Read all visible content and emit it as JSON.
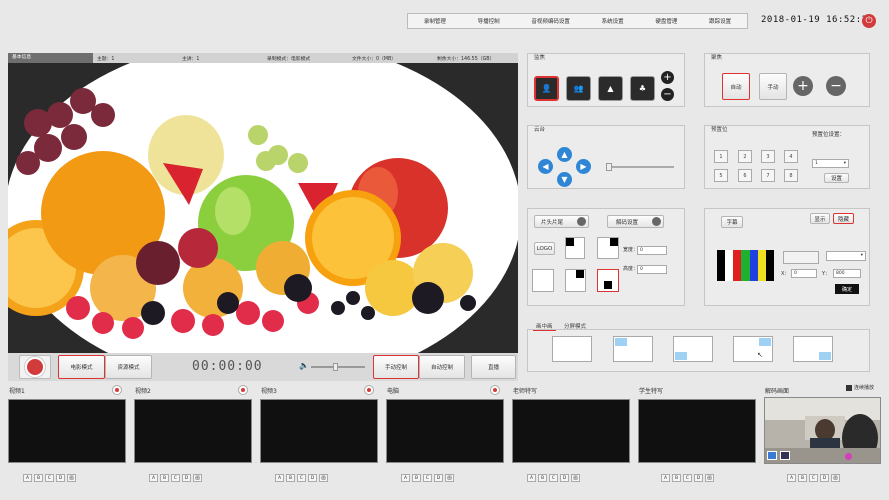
{
  "topnav": [
    "录制管理",
    "导播控制",
    "音视频编码设置",
    "系统设置",
    "硬盘管理",
    "跟踪设置"
  ],
  "clock": "2018-01-19 16:52:21",
  "power_icon": "power-icon",
  "infobar": [
    "基本信息",
    "主题：1",
    "主讲：1",
    "录制模式：电影模式",
    "文件大小：0（MB）",
    "剩余大小：146.55（GB）"
  ],
  "controls": {
    "movie_mode": "电影模式",
    "resource_mode": "资源模式",
    "timecode": "00:00:00",
    "manual_control": "手动控制",
    "auto_control": "自动控制",
    "live": "直播"
  },
  "sources": [
    {
      "label": "视频1"
    },
    {
      "label": "视频2"
    },
    {
      "label": "视频3"
    },
    {
      "label": "电脑"
    },
    {
      "label": "老师特写"
    },
    {
      "label": "学生特写"
    },
    {
      "label": "解码画面"
    }
  ],
  "continuous_play": "连续播放",
  "mini_buttons": [
    "A",
    "B",
    "C",
    "D",
    "画"
  ],
  "panels": {
    "camera": {
      "title": "监焦"
    },
    "focus": {
      "title": "聚焦",
      "auto": "自动",
      "manual": "手动"
    },
    "ptz": {
      "title": "云台"
    },
    "preset": {
      "title": "预置位",
      "set_label": "预置位设置：",
      "numbers": [
        "1",
        "2",
        "3",
        "4",
        "5",
        "6",
        "7",
        "8"
      ],
      "select_value": "1",
      "setup_btn": "设置"
    },
    "title_panel": {
      "intro_outro": "片头片尾",
      "decode": "解码设置",
      "logo": "LOGO",
      "width_label": "宽度：",
      "height_label": "高度：",
      "width_value": "0",
      "height_value": "0"
    },
    "subtitle": {
      "subtitle_btn": "字幕",
      "show": "显示",
      "hide": "隐藏",
      "x_label": "X：",
      "y_label": "Y：",
      "x_value": "0",
      "y_value": "800",
      "confirm": "确定"
    },
    "layout": {
      "tab1": "画中画",
      "tab2": "分屏模式"
    }
  },
  "colors": {
    "accent_red": "#d23b3b",
    "select_blue": "#9ed1f2"
  }
}
